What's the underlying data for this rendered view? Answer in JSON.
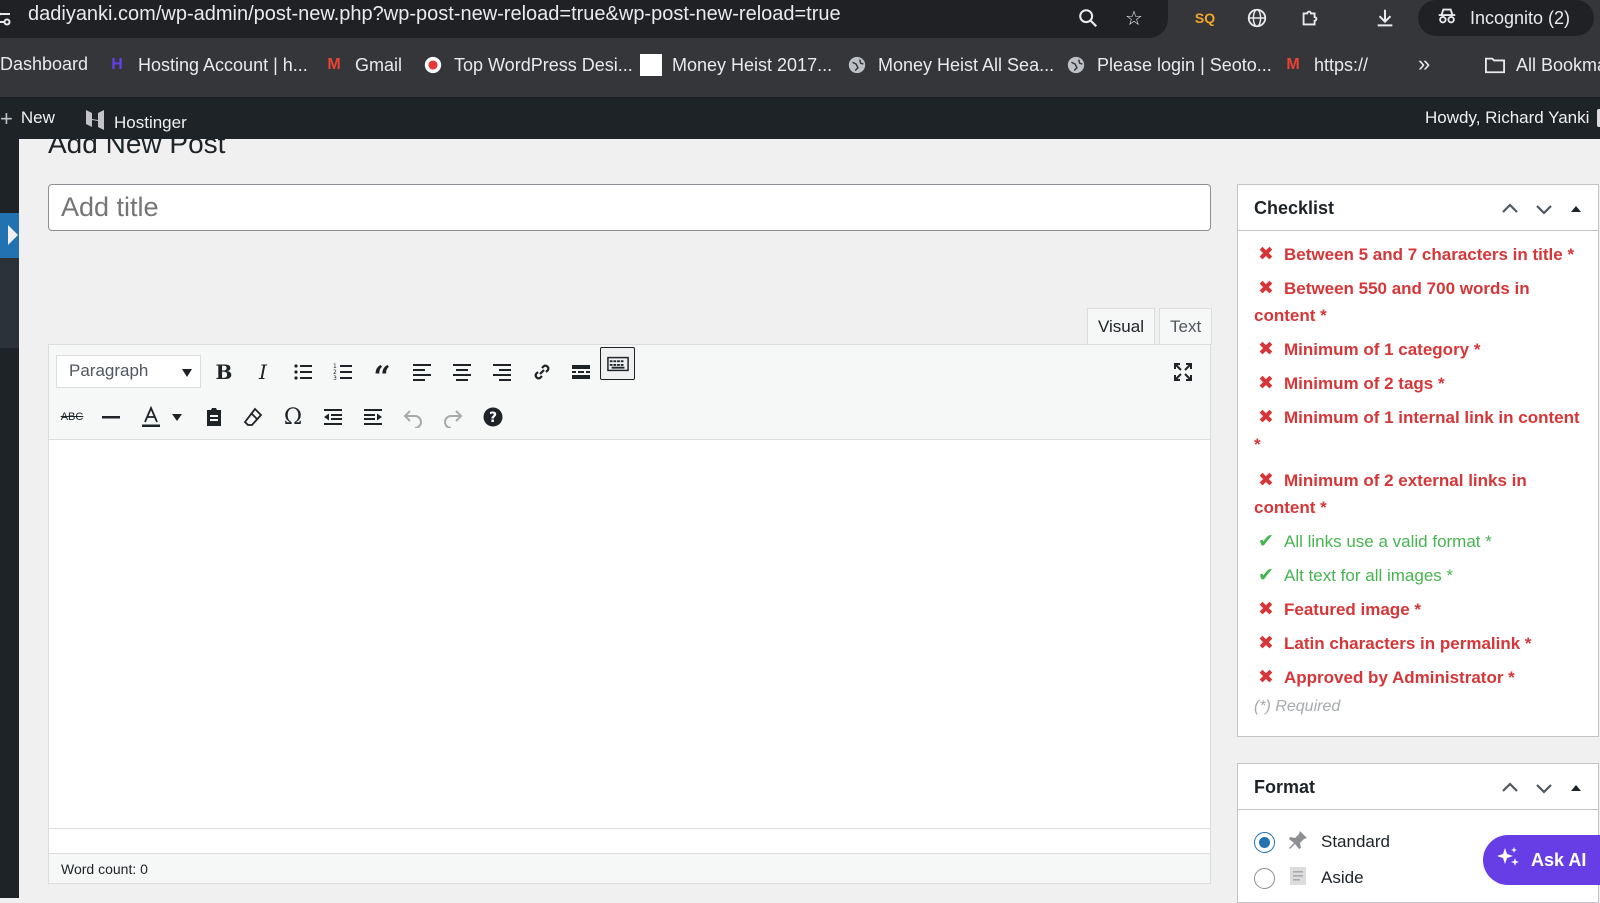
{
  "browser": {
    "url": "dadiyanki.com/wp-admin/post-new.php?wp-post-new-reload=true&wp-post-new-reload=true",
    "incognito_label": "Incognito (2)",
    "bookmarks": [
      {
        "label": "Dashboard"
      },
      {
        "label": "Hosting Account | h..."
      },
      {
        "label": "Gmail"
      },
      {
        "label": "Top WordPress Desi..."
      },
      {
        "label": "Money Heist 2017..."
      },
      {
        "label": "Money Heist All Sea..."
      },
      {
        "label": "Please login | Seoto..."
      },
      {
        "label": "https://"
      },
      {
        "label": "All Bookmarks"
      }
    ],
    "more_label": "»"
  },
  "adminbar": {
    "new_label": "New",
    "hostinger_label": "Hostinger",
    "howdy": "Howdy, Richard Yanki"
  },
  "page": {
    "title": "Add New Post",
    "title_placeholder": "Add title"
  },
  "editor": {
    "tabs": [
      "Visual",
      "Text"
    ],
    "format_select": "Paragraph",
    "word_count": "Word count: 0"
  },
  "checklist": {
    "title": "Checklist",
    "items": [
      {
        "text": "Between 5 and 7 characters in title *",
        "status": "fail"
      },
      {
        "text": "Between 550 and 700 words in content *",
        "status": "fail"
      },
      {
        "text": "Minimum of 1 category *",
        "status": "fail"
      },
      {
        "text": "Minimum of 2 tags *",
        "status": "fail"
      },
      {
        "text": "Minimum of 1 internal link in content *",
        "status": "fail"
      },
      {
        "text": "Minimum of 2 external links in content *",
        "status": "fail"
      },
      {
        "text": "All links use a valid format *",
        "status": "pass"
      },
      {
        "text": "Alt text for all images *",
        "status": "pass"
      },
      {
        "text": "Featured image *",
        "status": "fail"
      },
      {
        "text": "Latin characters in permalink *",
        "status": "fail"
      },
      {
        "text": "Approved by Administrator *",
        "status": "fail"
      }
    ],
    "required_note": "(*) Required"
  },
  "format_panel": {
    "title": "Format",
    "options": [
      {
        "label": "Standard",
        "selected": true
      },
      {
        "label": "Aside",
        "selected": false
      }
    ]
  },
  "ask_ai": "Ask AI",
  "colors": {
    "fail": "#d63638",
    "pass": "#46b450",
    "wp_blue": "#2271b1",
    "admin_bar": "#1d2327",
    "ask_ai": "#673de6"
  }
}
